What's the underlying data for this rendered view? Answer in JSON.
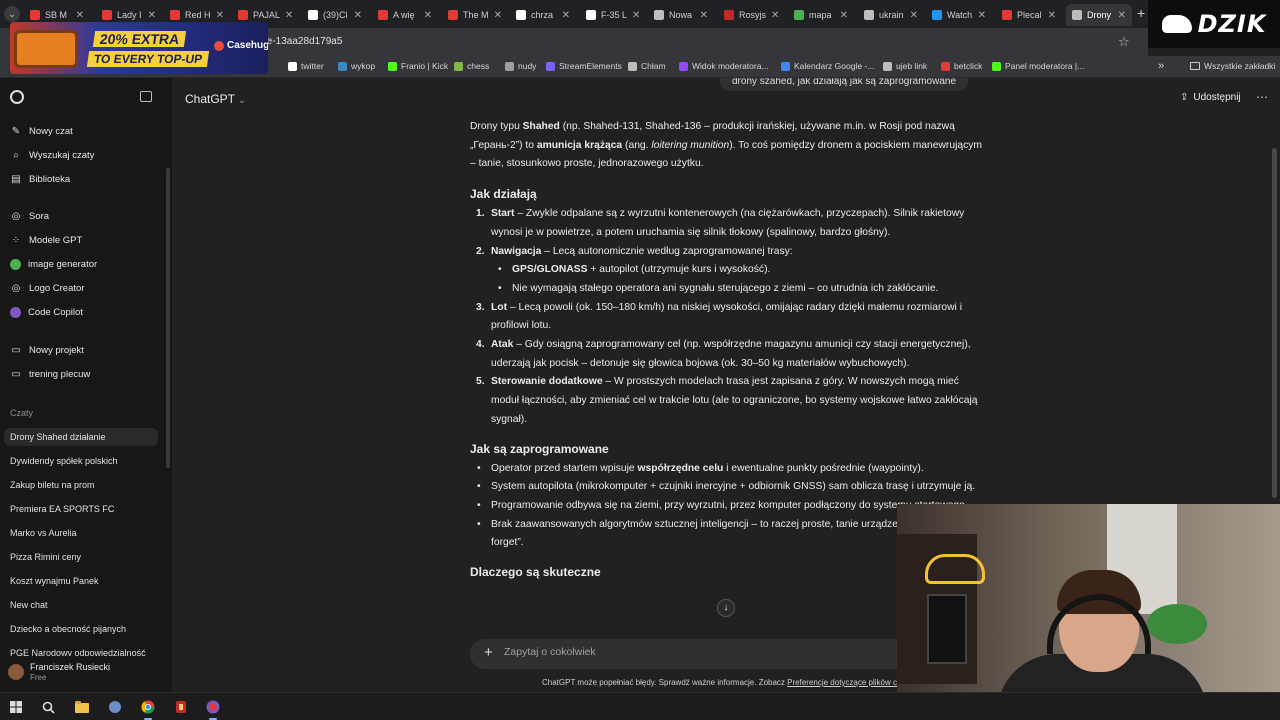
{
  "browser": {
    "tabs": [
      {
        "label": "SB M",
        "color": "#e53935"
      },
      {
        "label": "Lady I",
        "color": "#e53935"
      },
      {
        "label": "Red H",
        "color": "#e53935"
      },
      {
        "label": "PAJAL",
        "color": "#e53935"
      },
      {
        "label": "(39)Cl",
        "color": "#ffffff"
      },
      {
        "label": "A wię",
        "color": "#e53935"
      },
      {
        "label": "The M",
        "color": "#e53935"
      },
      {
        "label": "chrza",
        "color": "#ffffff"
      },
      {
        "label": "F-35 L",
        "color": "#ffffff"
      },
      {
        "label": "Nowa",
        "color": "#bdbdbd"
      },
      {
        "label": "Rosyjs",
        "color": "#c62828"
      },
      {
        "label": "mapa",
        "color": "#4caf50"
      },
      {
        "label": "ukrain",
        "color": "#bdbdbd"
      },
      {
        "label": "Watch",
        "color": "#2196f3"
      },
      {
        "label": "Plecal",
        "color": "#e53935"
      },
      {
        "label": "Drony",
        "color": "#bdbdbd"
      }
    ],
    "url": "fe-13aa28d179a5",
    "bookmarks": [
      {
        "label": "twitter",
        "color": "#ffffff"
      },
      {
        "label": "wykop",
        "color": "#3b88c3"
      },
      {
        "label": "Franio | Kick",
        "color": "#53fc18"
      },
      {
        "label": "chess",
        "color": "#81b64c"
      },
      {
        "label": "nudy",
        "color": "#9e9e9e"
      },
      {
        "label": "StreamElements",
        "color": "#7b61ff"
      },
      {
        "label": "Chłam",
        "color": "#bdbdbd"
      },
      {
        "label": "Widok moderatora...",
        "color": "#9146ff"
      },
      {
        "label": "Kalendarz Google -...",
        "color": "#4285f4"
      },
      {
        "label": "ujeb link",
        "color": "#bdbdbd"
      },
      {
        "label": "betclick",
        "color": "#e53935"
      },
      {
        "label": "Panel moderatora |...",
        "color": "#53fc18"
      }
    ],
    "bookmarks_more": "»",
    "all_bookmarks": "Wszystkie zakładki"
  },
  "ad": {
    "line1": "20% EXTRA",
    "line2": "TO EVERY TOP-UP",
    "brand": "Casehug"
  },
  "stream_logo": "DZIK",
  "sidebar": {
    "top_items": [
      {
        "label": "Nowy czat",
        "icon": "✎"
      },
      {
        "label": "Wyszukaj czaty",
        "icon": "⌕"
      },
      {
        "label": "Biblioteka",
        "icon": "▤"
      }
    ],
    "gpt_items": [
      {
        "label": "Sora",
        "icon": "◎",
        "color": ""
      },
      {
        "label": "Modele GPT",
        "icon": "⁘",
        "color": ""
      },
      {
        "label": "image generator",
        "icon": "",
        "color": "#4caf50"
      },
      {
        "label": "Logo Creator",
        "icon": "◎",
        "color": ""
      },
      {
        "label": "Code Copilot",
        "icon": "",
        "color": "#7e57c2"
      }
    ],
    "project_items": [
      {
        "label": "Nowy projekt",
        "icon": "▭"
      },
      {
        "label": "trening plecuw",
        "icon": "▭"
      }
    ],
    "chats_heading": "Czaty",
    "chats": [
      "Drony Shahed działanie",
      "Dywidendy spółek polskich",
      "Zakup biletu na prom",
      "Premiera EA SPORTS FC",
      "Marko vs Aurelia",
      "Pizza Rimini ceny",
      "Koszt wynajmu Panek",
      "New chat",
      "Dziecko a obecność pijanych",
      "PGE Narodowy odpowiedzialność"
    ],
    "profile_name": "Franciszek Rusiecki",
    "profile_plan": "Free"
  },
  "main": {
    "model": "ChatGPT",
    "share": "Udostępnij",
    "user_message": "drony szahed, jak działają jak są zaprogramowane",
    "composer_placeholder": "Zapytaj o cokolwiek",
    "disclaimer": "ChatGPT może popełniać błędy. Sprawdź ważne informacje. Zobacz",
    "disclaimer_link": "Preferencje dotyczące plików cookie",
    "answer": {
      "intro_1": "Drony typu ",
      "intro_b1": "Shahed",
      "intro_2": " (np. Shahed-131, Shahed-136 – produkcji irańskiej, używane m.in. w Rosji pod nazwą „Герань-2”) to ",
      "intro_b2": "amunicja krążąca",
      "intro_3": " (ang. ",
      "intro_i": "loitering munition",
      "intro_4": "). To coś pomiędzy dronem a pociskiem manewrującym – tanie, stosunkowo proste, jednorazowego użytku.",
      "h_how": "Jak działają",
      "steps": [
        {
          "num": "1.",
          "title": "Start",
          "text": " – Zwykle odpalane są z wyrzutni kontenerowych (na ciężarówkach, przyczepach). Silnik rakietowy wynosi je w powietrze, a potem uruchamia się silnik tłokowy (spalinowy, bardzo głośny)."
        },
        {
          "num": "2.",
          "title": "Nawigacja",
          "text": " – Lecą autonomicznie według zaprogramowanej trasy:"
        },
        {
          "num": "3.",
          "title": "Lot",
          "text": " – Lecą powoli (ok. 150–180 km/h) na niskiej wysokości, omijając radary dzięki małemu rozmiarowi i profilowi lotu."
        },
        {
          "num": "4.",
          "title": "Atak",
          "text": " – Gdy osiągną zaprogramowany cel (np. współrzędne magazynu amunicji czy stacji energetycznej), uderzają jak pocisk – detonuje się głowica bojowa (ok. 30–50 kg materiałów wybuchowych)."
        },
        {
          "num": "5.",
          "title": "Sterowanie dodatkowe",
          "text": " – W prostszych modelach trasa jest zapisana z góry. W nowszych mogą mieć moduł łączności, aby zmieniać cel w trakcie lotu (ale to ograniczone, bo systemy wojskowe łatwo zakłócają sygnał)."
        }
      ],
      "nav_b1": "GPS/GLONASS",
      "nav_t1": " + autopilot (utrzymuje kurs i wysokość).",
      "nav_t2": "Nie wymagają stałego operatora ani sygnału sterującego z ziemi – co utrudnia ich zakłócanie.",
      "h_prog": "Jak są zaprogramowane",
      "prog_1a": "Operator przed startem wpisuje ",
      "prog_1b": "współrzędne celu",
      "prog_1c": " i ewentualne punkty pośrednie (waypointy).",
      "prog_2": "System autopilota (mikrokomputer + czujniki inercyjne + odbiornik GNSS) sam oblicza trasę i utrzymuje ją.",
      "prog_3": "Programowanie odbywa się na ziemi, przy wyrzutni, przez komputer podłączony do systemu startowego.",
      "prog_4": "Brak zaawansowanych algorytmów sztucznej inteligencji – to raczej proste, tanie urządzenia typu „fire and forget”.",
      "h_why": "Dlaczego są skuteczne"
    }
  }
}
